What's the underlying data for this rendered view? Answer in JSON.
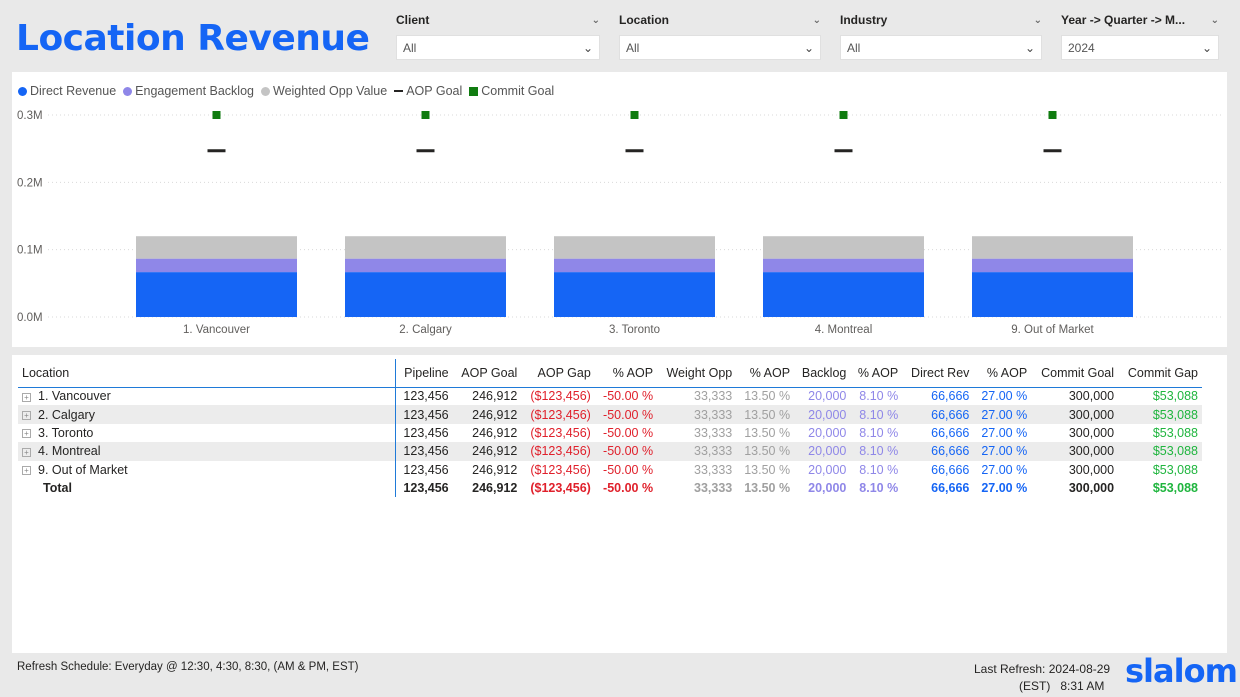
{
  "title": "Location Revenue",
  "filters": [
    {
      "label": "Client",
      "value": "All"
    },
    {
      "label": "Location",
      "value": "All"
    },
    {
      "label": "Industry",
      "value": "All"
    },
    {
      "label": "Year -> Quarter -> M...",
      "value": "2024"
    }
  ],
  "legend": [
    {
      "label": "Direct Revenue",
      "shape": "circle",
      "color": "#1565f5"
    },
    {
      "label": "Engagement Backlog",
      "shape": "circle",
      "color": "#8f87e8"
    },
    {
      "label": "Weighted Opp Value",
      "shape": "circle",
      "color": "#c4c4c4"
    },
    {
      "label": "AOP Goal",
      "shape": "dash",
      "color": "#252423"
    },
    {
      "label": "Commit Goal",
      "shape": "square",
      "color": "#107c10"
    }
  ],
  "chart_data": {
    "type": "bar",
    "stacked": true,
    "categories": [
      "1. Vancouver",
      "2. Calgary",
      "3. Toronto",
      "4. Montreal",
      "9. Out of Market"
    ],
    "series": [
      {
        "name": "Direct Revenue",
        "color": "#1565f5",
        "values": [
          66666,
          66666,
          66666,
          66666,
          66666
        ]
      },
      {
        "name": "Engagement Backlog",
        "color": "#8f87e8",
        "values": [
          20000,
          20000,
          20000,
          20000,
          20000
        ]
      },
      {
        "name": "Weighted Opp Value",
        "color": "#c4c4c4",
        "values": [
          33333,
          33333,
          33333,
          33333,
          33333
        ]
      }
    ],
    "markers": [
      {
        "name": "AOP Goal",
        "color": "#252423",
        "values": [
          246912,
          246912,
          246912,
          246912,
          246912
        ]
      },
      {
        "name": "Commit Goal",
        "color": "#107c10",
        "values": [
          300000,
          300000,
          300000,
          300000,
          300000
        ]
      }
    ],
    "y_ticks": [
      "0.0M",
      "0.1M",
      "0.2M",
      "0.3M"
    ],
    "ylim": [
      0,
      300000
    ],
    "grid": true,
    "legend_position": "top-left"
  },
  "table": {
    "headers": [
      "Location",
      "Pipeline",
      "AOP Goal",
      "AOP Gap",
      "% AOP",
      "Weight Opp",
      "% AOP",
      "Backlog",
      "% AOP",
      "Direct Rev",
      "% AOP",
      "Commit Goal",
      "Commit Gap"
    ],
    "rows": [
      [
        "1. Vancouver",
        "123,456",
        "246,912",
        "($123,456)",
        "-50.00 %",
        "33,333",
        "13.50 %",
        "20,000",
        "8.10 %",
        "66,666",
        "27.00 %",
        "300,000",
        "$53,088"
      ],
      [
        "2. Calgary",
        "123,456",
        "246,912",
        "($123,456)",
        "-50.00 %",
        "33,333",
        "13.50 %",
        "20,000",
        "8.10 %",
        "66,666",
        "27.00 %",
        "300,000",
        "$53,088"
      ],
      [
        "3. Toronto",
        "123,456",
        "246,912",
        "($123,456)",
        "-50.00 %",
        "33,333",
        "13.50 %",
        "20,000",
        "8.10 %",
        "66,666",
        "27.00 %",
        "300,000",
        "$53,088"
      ],
      [
        "4. Montreal",
        "123,456",
        "246,912",
        "($123,456)",
        "-50.00 %",
        "33,333",
        "13.50 %",
        "20,000",
        "8.10 %",
        "66,666",
        "27.00 %",
        "300,000",
        "$53,088"
      ],
      [
        "9. Out of Market",
        "123,456",
        "246,912",
        "($123,456)",
        "-50.00 %",
        "33,333",
        "13.50 %",
        "20,000",
        "8.10 %",
        "66,666",
        "27.00 %",
        "300,000",
        "$53,088"
      ]
    ],
    "total": [
      "Total",
      "123,456",
      "246,912",
      "($123,456)",
      "-50.00 %",
      "33,333",
      "13.50 %",
      "20,000",
      "8.10 %",
      "66,666",
      "27.00 %",
      "300,000",
      "$53,088"
    ]
  },
  "footer": {
    "refresh_schedule": "Refresh Schedule: Everyday @ 12:30, 4:30, 8:30, (AM & PM, EST)",
    "last_refresh_label": "Last Refresh:",
    "last_refresh_date": "2024-08-29",
    "tz": "(EST)",
    "last_refresh_time": "8:31 AM"
  },
  "logo": "slalom"
}
